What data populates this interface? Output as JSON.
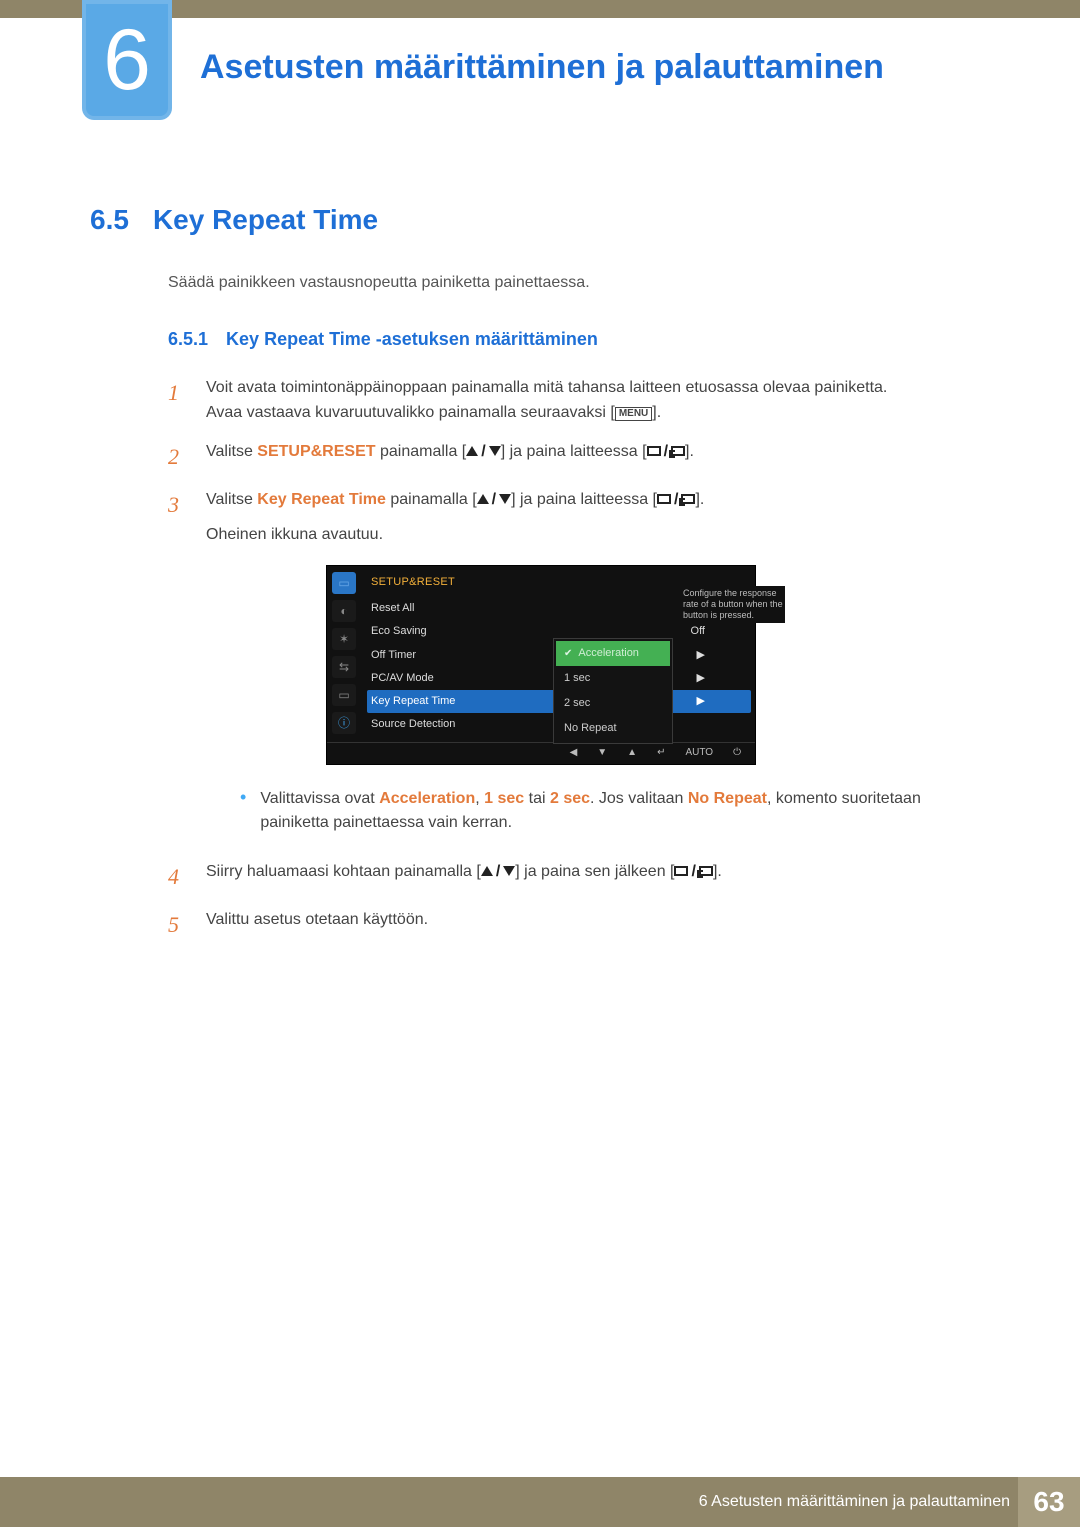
{
  "chapter": {
    "number": "6",
    "title": "Asetusten määrittäminen ja palauttaminen"
  },
  "section": {
    "number": "6.5",
    "title": "Key Repeat Time"
  },
  "lead": "Säädä painikkeen vastausnopeutta painiketta painettaessa.",
  "subsection": {
    "number": "6.5.1",
    "title": "Key Repeat Time -asetuksen määrittäminen"
  },
  "steps": {
    "s1": {
      "num": "1",
      "line1": "Voit avata toimintonäppäinoppaan painamalla mitä tahansa laitteen etuosassa olevaa painiketta.",
      "line2_a": "Avaa vastaava kuvaruutuvalikko painamalla seuraavaksi [",
      "menu_label": "MENU",
      "line2_b": "]."
    },
    "s2": {
      "num": "2",
      "a": "Valitse ",
      "em": "SETUP&RESET",
      "b": " painamalla [",
      "c": "] ja paina laitteessa [",
      "d": "]."
    },
    "s3": {
      "num": "3",
      "a": "Valitse ",
      "em": "Key Repeat Time",
      "b": " painamalla [",
      "c": "] ja paina laitteessa [",
      "d": "].",
      "e": "Oheinen ikkuna avautuu."
    },
    "bullet": {
      "a": "Valittavissa ovat ",
      "accel": "Acceleration",
      "comma1": ", ",
      "onesec": "1 sec",
      "tai": " tai ",
      "twosec": "2 sec",
      "b": ". Jos valitaan ",
      "norep": "No Repeat",
      "c": ", komento suoritetaan painiketta painettaessa vain kerran."
    },
    "s4": {
      "num": "4",
      "a": "Siirry haluamaasi kohtaan painamalla [",
      "b": "] ja paina sen jälkeen [",
      "c": "]."
    },
    "s5": {
      "num": "5",
      "a": "Valittu asetus otetaan käyttöön."
    }
  },
  "osd": {
    "header": "SETUP&RESET",
    "rows": {
      "reset": "Reset All",
      "eco": "Eco Saving",
      "eco_val": "Off",
      "timer": "Off Timer",
      "pcav": "PC/AV Mode",
      "keyrep": "Key Repeat Time",
      "srcdet": "Source Detection"
    },
    "popup": {
      "accel": "Acceleration",
      "onesec": "1 sec",
      "twosec": "2 sec",
      "norep": "No Repeat"
    },
    "hint": "Configure the response rate of a button when the button is pressed.",
    "footer": {
      "auto": "AUTO",
      "enter": "↵",
      "power": "⏻"
    }
  },
  "footer": {
    "label": "6 Asetusten määrittäminen ja palauttaminen",
    "page": "63"
  }
}
